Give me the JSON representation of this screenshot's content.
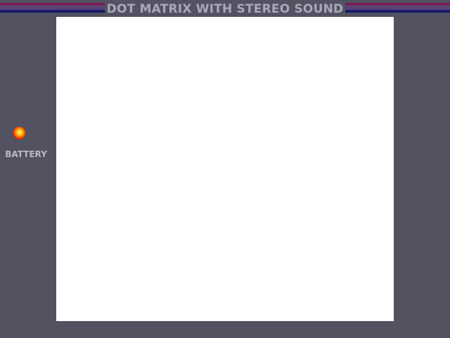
{
  "header": {
    "title": "DOT MATRIX WITH STEREO SOUND"
  },
  "power_indicator": {
    "label": "BATTERY",
    "state": "on"
  },
  "colors": {
    "bezel": "#525260",
    "stripe_magenta": "#7a1e5c",
    "stripe_purple": "#5a3a8a",
    "stripe_navy": "#1a1a6a",
    "title_text": "#a8a8b8",
    "screen": "#ffffff",
    "led": "#e0140a"
  }
}
